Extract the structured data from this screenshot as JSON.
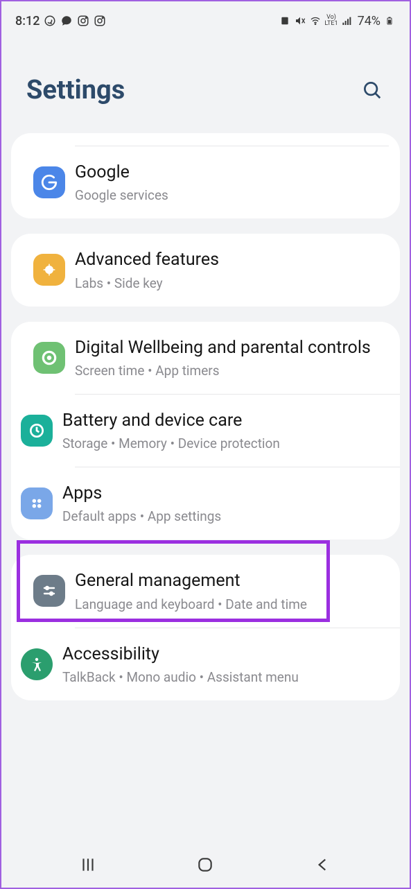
{
  "status": {
    "time": "8:12",
    "battery": "74%"
  },
  "header": {
    "title": "Settings"
  },
  "groups": [
    {
      "items": [
        {
          "title": "Google",
          "sub": "Google services"
        }
      ]
    },
    {
      "items": [
        {
          "title": "Advanced features",
          "sub": "Labs  •  Side key"
        }
      ]
    },
    {
      "items": [
        {
          "title": "Digital Wellbeing and parental controls",
          "sub": "Screen time  •  App timers"
        },
        {
          "title": "Battery and device care",
          "sub": "Storage  •  Memory  •  Device protection"
        },
        {
          "title": "Apps",
          "sub": "Default apps  •  App settings"
        }
      ]
    },
    {
      "items": [
        {
          "title": "General management",
          "sub": "Language and keyboard  •  Date and time"
        },
        {
          "title": "Accessibility",
          "sub": "TalkBack  •  Mono audio  •  Assistant menu"
        }
      ]
    }
  ],
  "colors": {
    "google": "#4b86e8",
    "advanced": "#f0b23e",
    "wellbeing": "#6fc173",
    "battery": "#1bb09a",
    "apps": "#7aa7e8",
    "general": "#6d7c89",
    "accessibility": "#2b9e6e"
  }
}
